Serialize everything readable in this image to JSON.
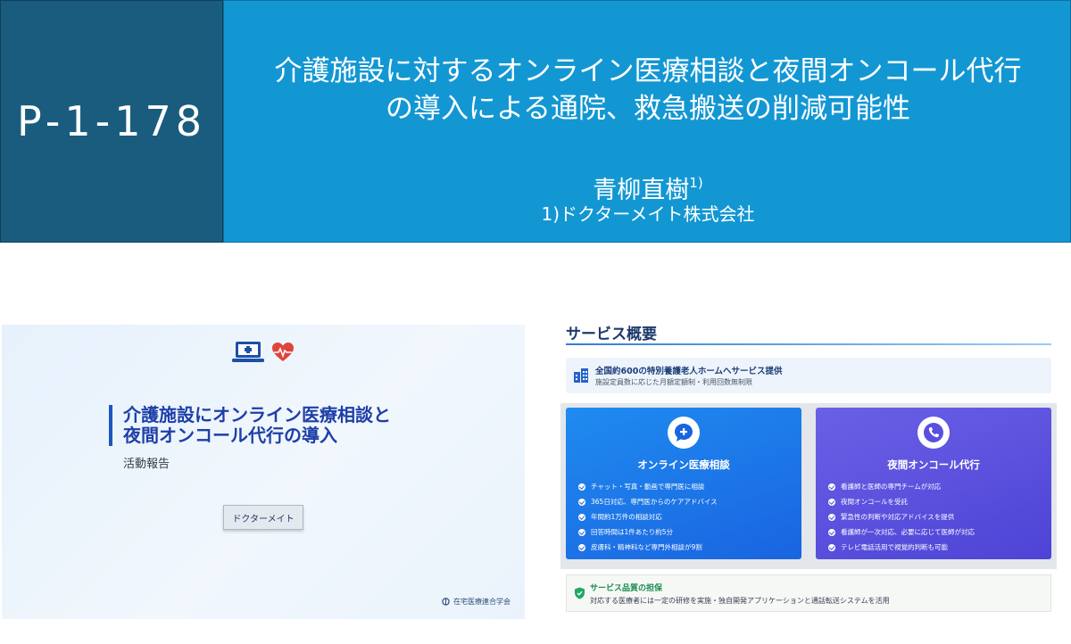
{
  "banner": {
    "code": "P-1-178",
    "title_line1": "介護施設に対するオンライン医療相談と夜間オンコール代行",
    "title_line2": "の導入による通院、救急搬送の削減可能性",
    "author_name": "青柳直樹",
    "author_sup": "1)",
    "affiliation": "1)ドクターメイト株式会社",
    "colors": {
      "code_bg": "#1a5c7e",
      "title_bg": "#1397d3"
    }
  },
  "slide_left": {
    "icons": [
      "laptop-medical-icon",
      "heart-pulse-icon"
    ],
    "title_line1": "介護施設にオンライン医療相談と",
    "title_line2": "夜間オンコール代行の導入",
    "subtitle": "活動報告",
    "button_label": "ドクターメイト",
    "society": "在宅医療連合学会"
  },
  "slide_right": {
    "title": "サービス概要",
    "info": {
      "line1": "全国約600の特別養護老人ホームへサービス提供",
      "line2": "施設定員数に応じた月額定額制・利用回数無制限"
    },
    "cards": [
      {
        "icon": "chat-plus-icon",
        "title": "オンライン医療相談",
        "items": [
          "チャット・写真・動画で専門医に相談",
          "365日対応、専門医からのケアアドバイス",
          "年間約1万件の相談対応",
          "回答時間は1件あたり約5分",
          "皮膚科・精神科など専門外相談が9割"
        ]
      },
      {
        "icon": "phone-icon",
        "title": "夜間オンコール代行",
        "items": [
          "看護師と医師の専門チームが対応",
          "夜間オンコールを受託",
          "緊急性の判断や対応アドバイスを提供",
          "看護師が一次対応、必要に応じて医師が対応",
          "テレビ電話活用で視覚的判断も可能"
        ]
      }
    ],
    "quality": {
      "title": "サービス品質の担保",
      "text": "対応する医療者には一定の研修を実施・独自開発アプリケーションと通話転送システムを活用"
    }
  }
}
